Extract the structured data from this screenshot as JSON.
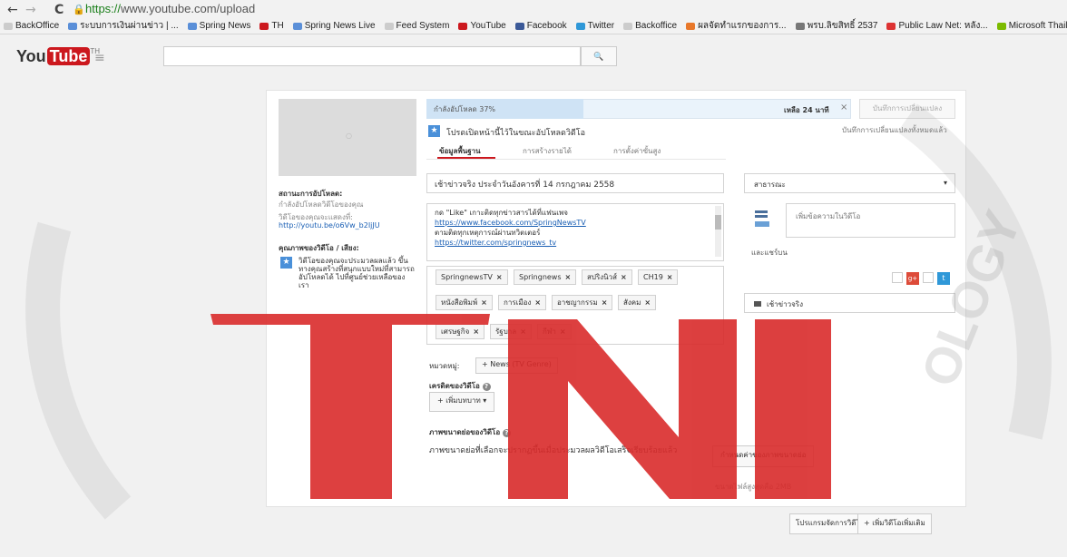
{
  "browser": {
    "back": "←",
    "forward": "→",
    "reload": "C",
    "url_secure": "https://",
    "url_host": "www.youtube.com",
    "url_path": "/upload",
    "bookmarks": [
      {
        "label": "BackOffice",
        "color": "#cccccc"
      },
      {
        "label": "ระบบการเงินผ่านข่าว | ...",
        "color": "#5a8fd8"
      },
      {
        "label": "Spring News",
        "color": "#5a8fd8"
      },
      {
        "label": "TH",
        "color": "#cc181e"
      },
      {
        "label": "Spring News Live",
        "color": "#5a8fd8"
      },
      {
        "label": "Feed System",
        "color": "#cccccc"
      },
      {
        "label": "YouTube",
        "color": "#cc181e"
      },
      {
        "label": "Facebook",
        "color": "#3b5998"
      },
      {
        "label": "Twitter",
        "color": "#2f98d8"
      },
      {
        "label": "Backoffice",
        "color": "#cccccc"
      },
      {
        "label": "ผลจัดทำแรกของการ...",
        "color": "#e8782a"
      },
      {
        "label": "พรบ.ลิขสิทธิ์ 2537",
        "color": "#777777"
      },
      {
        "label": "Public Law Net: หลัง...",
        "color": "#d33"
      },
      {
        "label": "Microsoft Thailand",
        "color": "#7cbb00"
      }
    ]
  },
  "header": {
    "logo_you": "You",
    "logo_tube": "Tube",
    "logo_region": "TH",
    "menu_icon": "≡",
    "search_value": "",
    "search_icon": "🔍"
  },
  "upload": {
    "spinner": "○",
    "status_heading": "สถานะการอัปโหลด:",
    "status_text": "กำลังอัปโหลดวิดีโอของคุณ",
    "link_label": "วิดีโอของคุณจะแสดงที่:",
    "video_link": "http://youtu.be/o6Vw_b2IjJU",
    "quality_heading": "คุณภาพของวิดีโอ / เสียง:",
    "quality_text": "วิดีโอของคุณจะประมวลผลแล้ว ขึ้นทางคุณสร้างที่สนุกแบบใหม่ที่สามารถอัปโหลดได้ ไปที่ศูนย์ช่วยเหลือของเรา",
    "progress_text": "กำลังอัปโหลด 37%",
    "progress_percent": 37,
    "time_left": "เหลือ 24 นาที",
    "close": "×",
    "publish_button": "บันทึกการเปลี่ยนแปลง",
    "saved_text": "บันทึกการเปลี่ยนแปลงทั้งหมดแล้ว",
    "keep_open": "โปรดเปิดหน้านี้ไว้ในขณะอัปโหลดวิดีโอ",
    "tabs": [
      "ข้อมูลพื้นฐาน",
      "การสร้างรายได้",
      "การตั้งค่าขั้นสูง"
    ],
    "title_value": "เช้าข่าวจริง ประจำวันอังคารที่ 14 กรกฎาคม 2558",
    "description_lines": [
      "กด \"Like\" เกาะติดทุกข่าวสารได้ที่แฟนเพจ",
      "https://www.facebook.com/SpringNewsTV",
      "ตามติดทุกเหตุการณ์ผ่านทวิตเตอร์",
      "https://twitter.com/springnews_tv"
    ],
    "tags": [
      "SpringnewsTV",
      "Springnews",
      "สปริงนิวส์",
      "CH19",
      "หนังสือพิมพ์",
      "การเมือง",
      "อาชญากรรม",
      "สังคม",
      "เศรษฐกิจ",
      "รัฐบาล",
      "กีฬา"
    ],
    "tag_remove": "×",
    "privacy": "สาธารณะ",
    "privacy_arrow": "▾",
    "message_placeholder": "เพิ่มข้อความในวิดีโอ",
    "and_share": "และแชร์บน",
    "gplus": "g+",
    "twitter": "t",
    "playlist": "เช้าข่าวจริง",
    "category_label": "หมวดหมู่:",
    "category_value": "+ News (TV Genre)",
    "credits_label": "เครดิตของวิดีโอ",
    "add_role": "+ เพิ่มบทบาท ▾",
    "thumb_label": "ภาพขนาดย่อของวิดีโอ",
    "thumb_message": "ภาพขนาดย่อที่เลือกจะปรากฏขึ้นเมื่อประมวลผลวิดีโอเสร็จเรียบร้อยแล้ว",
    "thumb_button": "กำหนดค่าของภาพขนาดย่อ",
    "max_size": "ขนาดไฟล์สูงสุดคือ 2MB",
    "footer_manager": "โปรแกรมจัดการวิดีโอ",
    "footer_add_more": "+ เพิ่มวิดีโอเพิ่มเติม"
  },
  "watermark": {
    "text": "TNI",
    "color": "#d92b2b",
    "ring_text_right": "OLOGY"
  }
}
